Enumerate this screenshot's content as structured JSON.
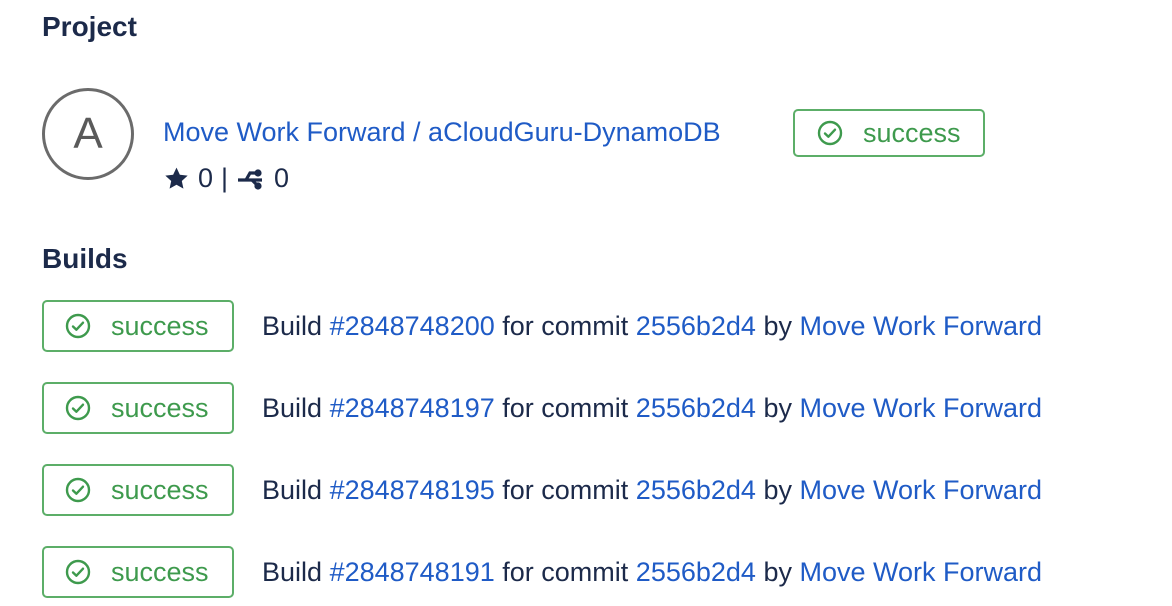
{
  "project_section": {
    "heading": "Project",
    "avatar_letter": "A",
    "project_name": "Move Work Forward / aCloudGuru-DynamoDB",
    "stars": "0",
    "separator": "|",
    "forks": "0",
    "status": "success",
    "icons": {
      "star": "star-icon",
      "fork": "fork-icon",
      "status": "check-circle-icon"
    }
  },
  "builds_section": {
    "heading": "Builds",
    "builds": [
      {
        "status": "success",
        "build_word": "Build",
        "build_number": "#2848748200",
        "for_commit": "for commit",
        "commit": "2556b2d4",
        "by": "by",
        "author": "Move Work Forward"
      },
      {
        "status": "success",
        "build_word": "Build",
        "build_number": "#2848748197",
        "for_commit": "for commit",
        "commit": "2556b2d4",
        "by": "by",
        "author": "Move Work Forward"
      },
      {
        "status": "success",
        "build_word": "Build",
        "build_number": "#2848748195",
        "for_commit": "for commit",
        "commit": "2556b2d4",
        "by": "by",
        "author": "Move Work Forward"
      },
      {
        "status": "success",
        "build_word": "Build",
        "build_number": "#2848748191",
        "for_commit": "for commit",
        "commit": "2556b2d4",
        "by": "by",
        "author": "Move Work Forward"
      }
    ]
  },
  "colors": {
    "link": "#1f5bc6",
    "success": "#3e9a4d",
    "heading": "#1c2a4a"
  }
}
